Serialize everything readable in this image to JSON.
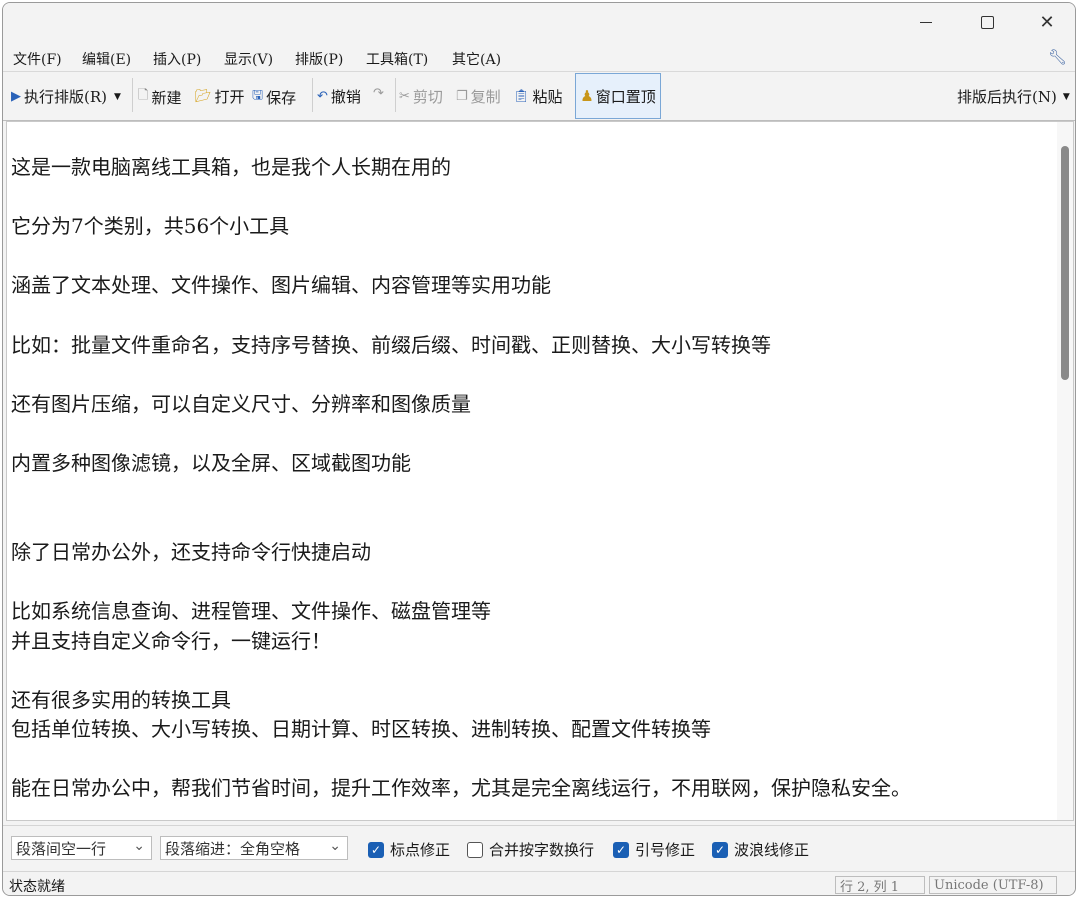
{
  "menubar": {
    "items": [
      "文件(F)",
      "编辑(E)",
      "插入(P)",
      "显示(V)",
      "排版(P)",
      "工具箱(T)",
      "其它(A)"
    ],
    "settings_icon": "wrench-icon"
  },
  "toolbar": {
    "run_format": "执行排版(R)",
    "new": "新建",
    "open": "打开",
    "save": "保存",
    "undo": "撤销",
    "cut": "剪切",
    "copy": "复制",
    "paste": "粘贴",
    "pin_window": "窗口置顶",
    "after_format": "排版后执行(N)"
  },
  "editor": {
    "lines": [
      "这是一款电脑离线工具箱，也是我个人长期在用的",
      "",
      "它分为7个类别，共56个小工具",
      "",
      "涵盖了文本处理、文件操作、图片编辑、内容管理等实用功能",
      "",
      "比如：批量文件重命名，支持序号替换、前缀后缀、时间戳、正则替换、大小写转换等",
      "",
      "还有图片压缩，可以自定义尺寸、分辨率和图像质量",
      "",
      "内置多种图像滤镜，以及全屏、区域截图功能",
      "",
      "",
      "除了日常办公外，还支持命令行快捷启动",
      "",
      "比如系统信息查询、进程管理、文件操作、磁盘管理等",
      "并且支持自定义命令行，一键运行！",
      "",
      "还有很多实用的转换工具",
      "包括单位转换、大小写转换、日期计算、时区转换、进制转换、配置文件转换等",
      "",
      "能在日常办公中，帮我们节省时间，提升工作效率，尤其是完全离线运行，不用联网，保护隐私安全。"
    ]
  },
  "options": {
    "paragraph_spacing": "段落间空一行",
    "paragraph_indent": "段落缩进：全角空格",
    "punct_fix": {
      "label": "标点修正",
      "checked": true
    },
    "merge_wrap": {
      "label": "合并按字数换行",
      "checked": false
    },
    "quote_fix": {
      "label": "引号修正",
      "checked": true
    },
    "tilde_fix": {
      "label": "波浪线修正",
      "checked": true
    }
  },
  "status": {
    "text": "状态就绪",
    "position": "行 2, 列 1",
    "encoding": "Unicode (UTF-8)"
  },
  "colors": {
    "accent": "#1a5fb4",
    "pin_highlight": "#e6f0fb"
  }
}
